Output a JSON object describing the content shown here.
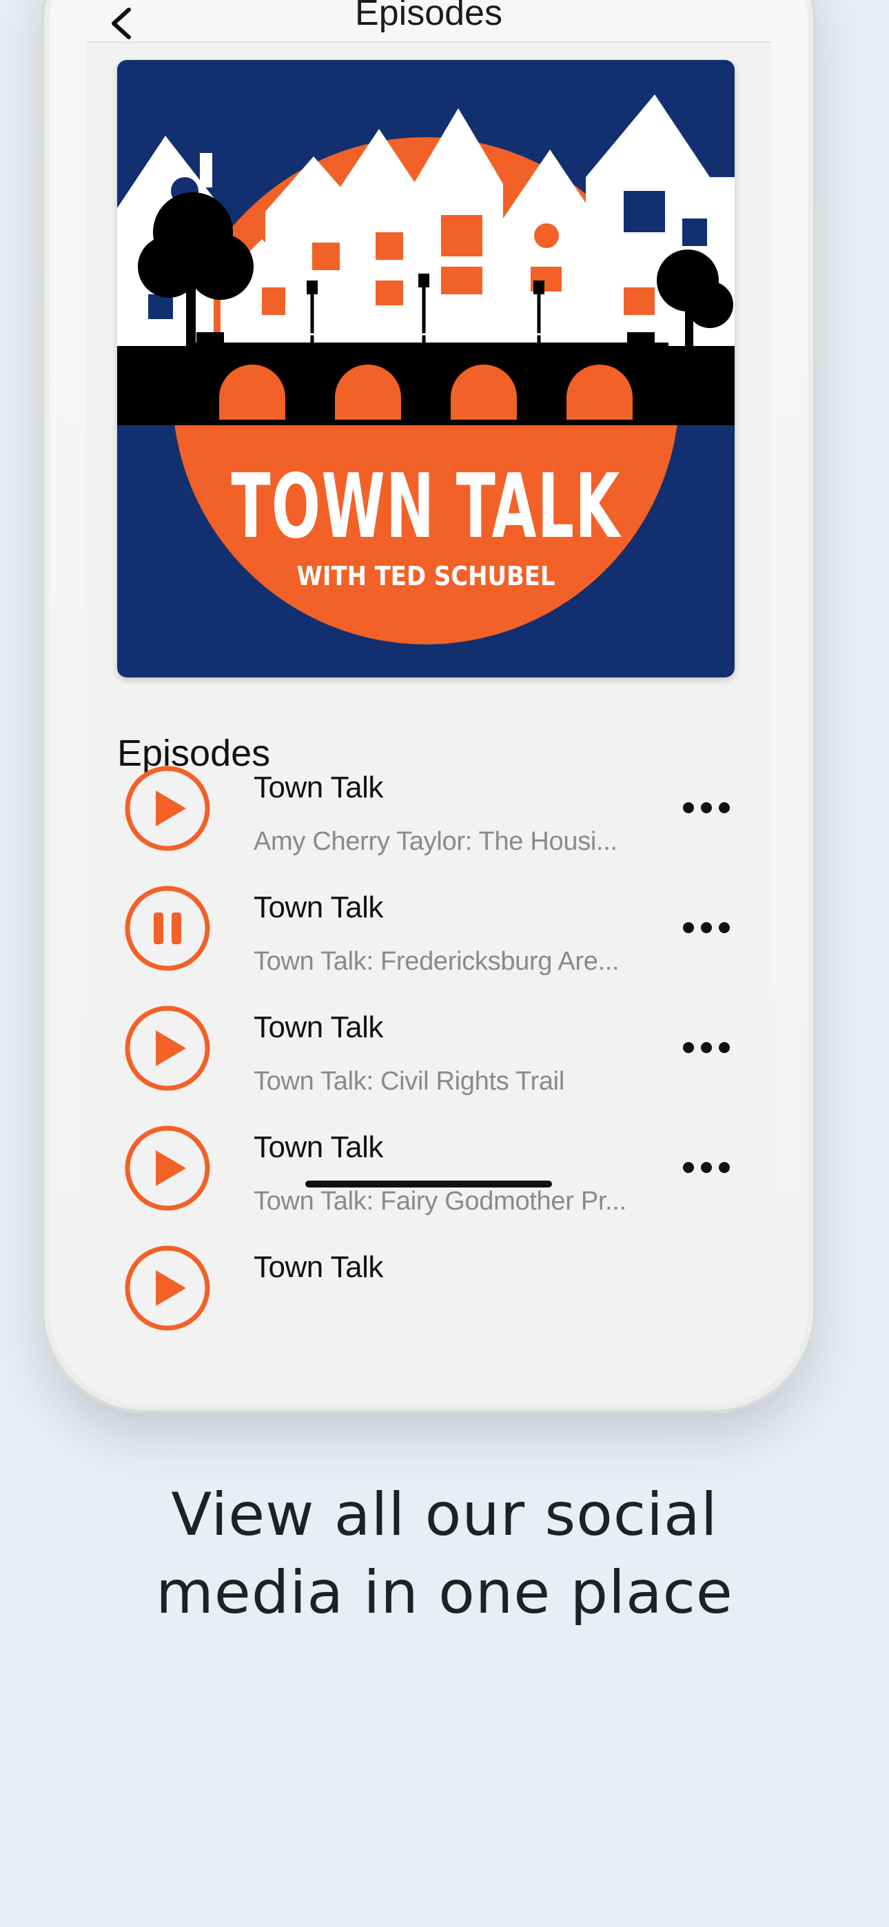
{
  "nav": {
    "title": "Episodes",
    "back_icon": "chevron-left-icon"
  },
  "artwork": {
    "title": "TOWN TALK",
    "subtitle": "WITH TED SCHUBEL",
    "colors": {
      "background": "#123070",
      "sun": "#f26127",
      "houses": "#ffffff",
      "bridge": "#000000"
    }
  },
  "episodes": {
    "heading": "Episodes",
    "accent_color": "#f26127",
    "items": [
      {
        "title": "Town Talk",
        "subtitle": "Amy Cherry Taylor:  The Housi...",
        "state": "play",
        "icon": "play-icon"
      },
      {
        "title": "Town Talk",
        "subtitle": "Town Talk:  Fredericksburg Are...",
        "state": "pause",
        "icon": "pause-icon"
      },
      {
        "title": "Town Talk",
        "subtitle": "Town Talk:  Civil Rights Trail",
        "state": "play",
        "icon": "play-icon"
      },
      {
        "title": "Town Talk",
        "subtitle": "Town Talk:  Fairy Godmother Pr...",
        "state": "play",
        "icon": "play-icon"
      },
      {
        "title": "Town Talk",
        "subtitle": "",
        "state": "play",
        "icon": "play-icon"
      }
    ],
    "more_icon": "more-horizontal-icon"
  },
  "caption": {
    "line1": "View all our social",
    "line2": "media in one place"
  }
}
